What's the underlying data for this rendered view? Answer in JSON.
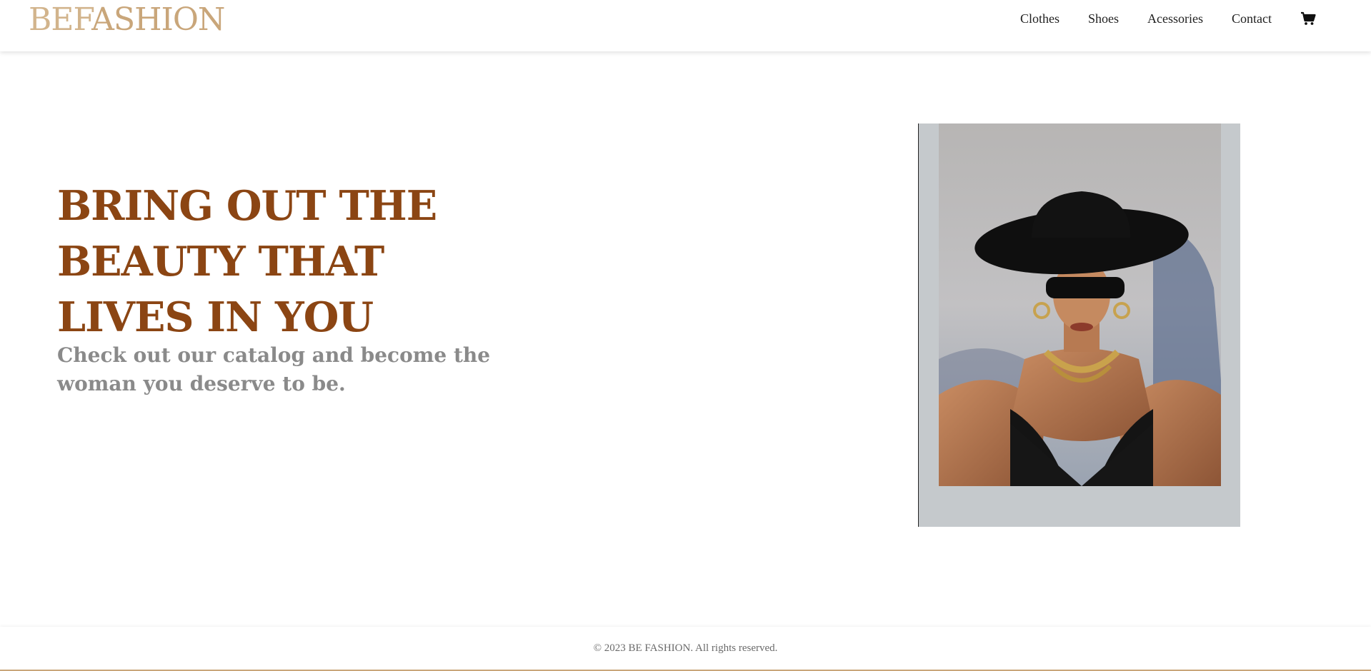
{
  "header": {
    "logo_part1": "BEF",
    "logo_part2": "ASHION",
    "nav": [
      {
        "label": "Clothes"
      },
      {
        "label": "Shoes"
      },
      {
        "label": "Acessories"
      },
      {
        "label": "Contact"
      }
    ],
    "cart_icon": "shopping-cart-icon"
  },
  "hero": {
    "title": "BRING OUT THE BEAUTY THAT LIVES IN YOU",
    "subtitle": "Check out our catalog and become the woman you deserve to be."
  },
  "footer": {
    "copyright": "© 2023 BE FASHION. All rights reserved."
  },
  "colors": {
    "logo": "#d2b48c",
    "title": "#8b4513",
    "subtitle": "#8a8a8a"
  }
}
